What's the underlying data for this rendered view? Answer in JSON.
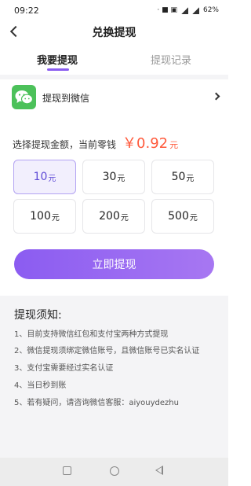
{
  "status_bar": {
    "time": "09:22",
    "indicators": "· ■ ▣",
    "battery": "62%"
  },
  "nav": {
    "title": "兑换提现"
  },
  "tabs": [
    {
      "label": "我要提现",
      "active": true
    },
    {
      "label": "提现记录",
      "active": false
    }
  ],
  "method": {
    "label": "提现到微信",
    "icon": "wechat-icon"
  },
  "amount": {
    "prompt": "选择提现金额，当前零钱",
    "balance": "￥0.92",
    "balance_unit": "元",
    "options": [
      {
        "value": "10",
        "unit": "元",
        "selected": true
      },
      {
        "value": "30",
        "unit": "元",
        "selected": false
      },
      {
        "value": "50",
        "unit": "元",
        "selected": false
      },
      {
        "value": "100",
        "unit": "元",
        "selected": false
      },
      {
        "value": "200",
        "unit": "元",
        "selected": false
      },
      {
        "value": "500",
        "unit": "元",
        "selected": false
      }
    ]
  },
  "actions": {
    "withdraw_label": "立即提现"
  },
  "notice": {
    "title": "提现须知:",
    "items": [
      "1、目前支持微信红包和支付宝两种方式提现",
      "2、微信提现须绑定微信账号，且微信账号已实名认证",
      "3、支付宝需要经过实名认证",
      "4、当日秒到账",
      "5、若有疑问，请咨询微信客服：aiyouydezhu"
    ]
  },
  "colors": {
    "accent": "#8b5cf1",
    "balance": "#ff5a3c",
    "wechat": "#4cc15a",
    "selected_bg": "#f2effd"
  }
}
